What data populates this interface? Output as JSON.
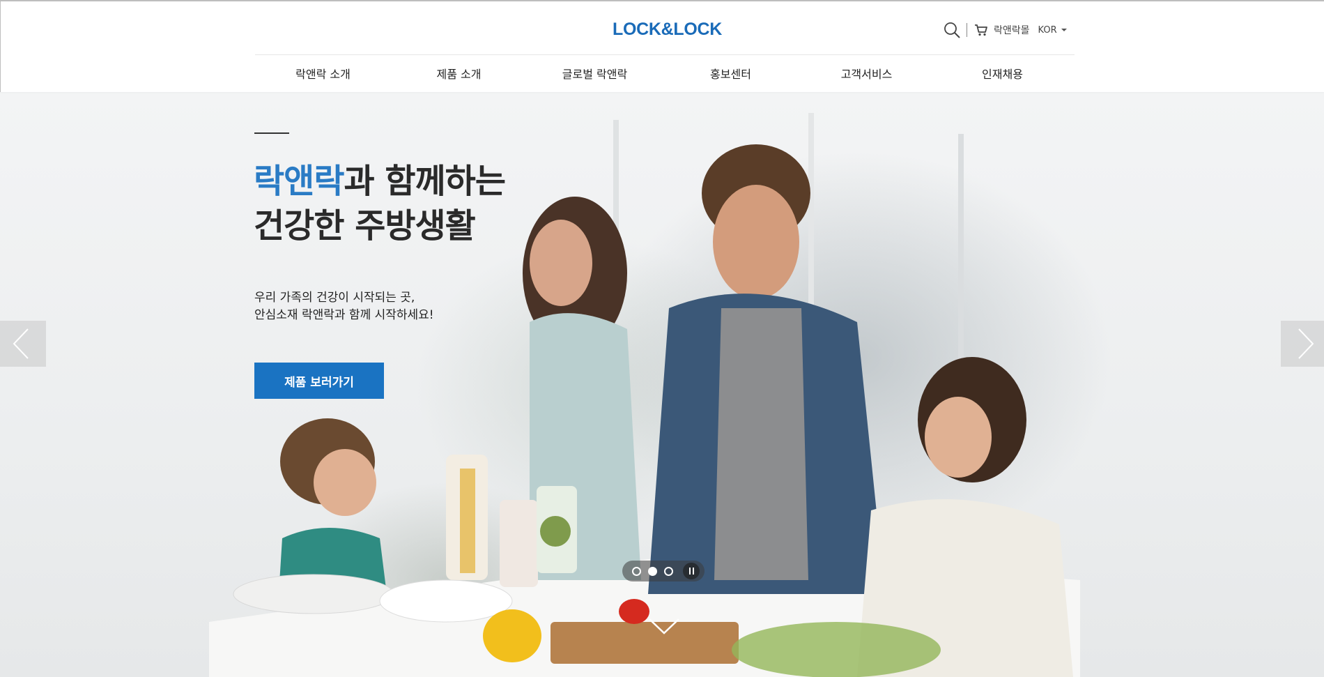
{
  "header": {
    "logo_text": "LOCK&LOCK",
    "brand_color": "#1a6bb8",
    "util": {
      "search_icon": "search-icon",
      "cart_icon": "cart-icon",
      "mall_label": "락앤락몰",
      "lang_label": "KOR"
    },
    "nav": [
      {
        "label": "락앤락 소개"
      },
      {
        "label": "제품 소개"
      },
      {
        "label": "글로벌 락앤락"
      },
      {
        "label": "홍보센터"
      },
      {
        "label": "고객서비스"
      },
      {
        "label": "인재채용"
      }
    ]
  },
  "hero": {
    "headline_accent": "락앤락",
    "headline_rest": "과 함께하는",
    "headline_line2": "건강한 주방생활",
    "subcopy_line1": "우리 가족의 건강이 시작되는 곳,",
    "subcopy_line2": "안심소재 락앤락과 함께 시작하세요!",
    "cta_label": "제품 보러가기",
    "accent_color": "#2a7bc5",
    "cta_color": "#1a73c2",
    "slides": {
      "count": 3,
      "active_index": 1
    },
    "controls": {
      "prev_icon": "chevron-left-icon",
      "next_icon": "chevron-right-icon",
      "pause_icon": "pause-icon",
      "scroll_icon": "chevron-down-icon"
    }
  }
}
